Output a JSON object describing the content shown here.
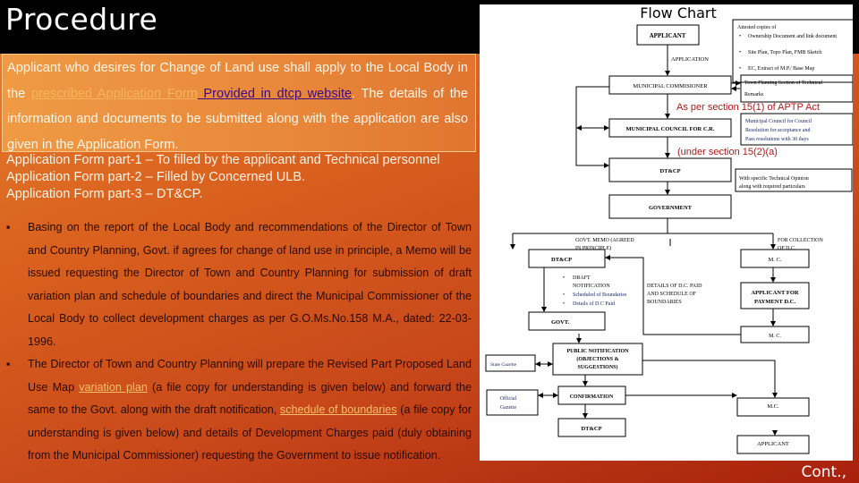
{
  "slide": {
    "title": "Procedure",
    "continuation": "Cont.,"
  },
  "intro": {
    "part1": "Applicant who desires for Change of Land use shall apply to the Local Body in the ",
    "link_form": "prescribed Application Form",
    "link_website": " Provided in dtcp website",
    "part2": ". The details of the information and documents to be submitted along with the application are also given in the Application Form."
  },
  "form_parts": [
    "Application Form part-1 – To filled by the applicant and Technical personnel",
    "Application Form part-2 – Filled by Concerned ULB.",
    "Application Form part-3 – DT&CP."
  ],
  "bullets": [
    {
      "text": "Basing on the report of the Local Body and recommendations of the Director of Town and Country Planning, Govt. if agrees for change of land use in principle, a Memo will be issued requesting the Director of Town and Country Planning for submission of draft variation plan and schedule of boundaries and direct the Municipal Commissioner of the Local Body to collect development charges as per G.O.Ms.No.158 M.A., dated: 22-03-1996."
    },
    {
      "text_a": "The Director of Town and Country Planning will  prepare the Revised Part Proposed Land Use Map ",
      "link_a": "variation plan",
      "text_b": " (a file copy for understanding is given below) and forward the same to the Govt. along with the draft notification, ",
      "link_b": "schedule of boundaries",
      "text_c": " (a file copy for understanding is given below) and details of Development Charges paid (duly obtaining from the Municipal Commissioner) requesting the Government to issue notification."
    }
  ],
  "flowchart": {
    "title": "Flow Chart",
    "applicant": "APPLICANT",
    "application_label": "APPLICATION",
    "attested_title": "Attested copies of",
    "attested_items": [
      "Ownership Document and link document",
      "Site Plan, Topo Plan, FMB Sketch",
      "EC, Extract of M.P./ Base Map"
    ],
    "municipal_commissioner": "MUNICIPAL COMMISIONER",
    "town_planning": [
      "Town Planning Section of Technical",
      "Remarks"
    ],
    "section_15_1": "As per section 15(1) of APTP Act",
    "municipal_council": "MUNICIPAL COUNCIL FOR C.R.",
    "council_note": [
      "Municipal Council for Council",
      "Resolution for acceptance and",
      "Pass resolutions with 30 days"
    ],
    "section_15_2": "(under section 15(2)(a)",
    "dtcp": "DT&CP",
    "tech_opinion": [
      "With specific Technical Opinion",
      "along with required particulars"
    ],
    "government": "GOVERNMENT",
    "govt_memo": [
      "GOVT. MEMO (AGREED",
      "IN PRINCIPLE)"
    ],
    "for_collection": [
      "FOR COLLECTION",
      "OF D.C."
    ],
    "dtcp2": "DT&CP",
    "mc": "M. C.",
    "draft_items": [
      "DRAFT",
      "NOTIFICATION",
      "Scheduled of Boundaries",
      "Details of D.C Paid"
    ],
    "details_dc": [
      "DETAILS OF D.C. PAID",
      "AND SCHEDULE OF",
      "BOUNDARIES"
    ],
    "applicant_payment": [
      "APPLICANT FOR",
      "PAYMENT D.C."
    ],
    "govt": "GOVT.",
    "mc2": "M. C.",
    "state_gazette": "State Gazette",
    "public_notification": [
      "PUBLIC NOTIFICATION",
      "(OBJECTIONS &",
      "SUGGESTIONS)"
    ],
    "official_gazette": [
      "Official",
      "Gazette"
    ],
    "confirmation": "CONFIRMATION",
    "mc3": "M.C.",
    "dtcp3": "DT&CP",
    "applicant_final": "APPLICANT"
  },
  "colors": {
    "bg_orange": "#e07530",
    "bg_dark_red": "#a8200c",
    "note_red": "#b01818",
    "link_purple": "#3a0a8a"
  }
}
